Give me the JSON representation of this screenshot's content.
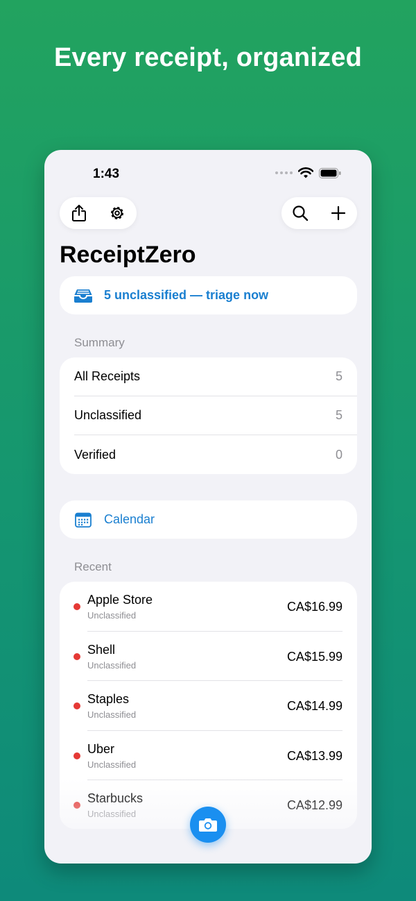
{
  "headline": "Every receipt, organized",
  "status_bar": {
    "time": "1:43"
  },
  "toolbar": {
    "left_icons": [
      "share-icon",
      "gear-icon"
    ],
    "right_icons": [
      "search-icon",
      "plus-icon"
    ]
  },
  "app_title": "ReceiptZero",
  "triage": {
    "icon": "inbox-tray-icon",
    "label": "5 unclassified — triage now"
  },
  "summary": {
    "header": "Summary",
    "rows": [
      {
        "label": "All Receipts",
        "count": "5"
      },
      {
        "label": "Unclassified",
        "count": "5"
      },
      {
        "label": "Verified",
        "count": "0"
      }
    ]
  },
  "calendar": {
    "icon": "calendar-icon",
    "label": "Calendar"
  },
  "recent": {
    "header": "Recent",
    "items": [
      {
        "merchant": "Apple Store",
        "status": "Unclassified",
        "amount": "CA$16.99"
      },
      {
        "merchant": "Shell",
        "status": "Unclassified",
        "amount": "CA$15.99"
      },
      {
        "merchant": "Staples",
        "status": "Unclassified",
        "amount": "CA$14.99"
      },
      {
        "merchant": "Uber",
        "status": "Unclassified",
        "amount": "CA$13.99"
      },
      {
        "merchant": "Starbucks",
        "status": "Unclassified",
        "amount": "CA$12.99"
      }
    ]
  },
  "colors": {
    "accent": "#1a7fd0",
    "unclassified_dot": "#e53935",
    "background_top": "#22a35f",
    "background_bottom": "#0e8a7a"
  },
  "fab": {
    "icon": "camera-icon"
  }
}
